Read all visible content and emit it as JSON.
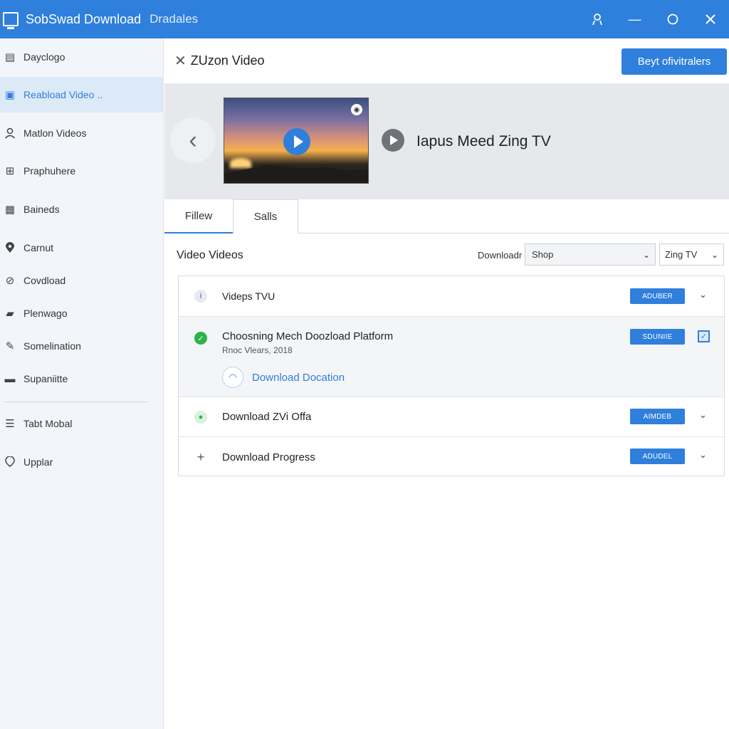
{
  "titlebar": {
    "title": "SobSwad Download",
    "subtitle": "Dradales"
  },
  "sidebar": {
    "items": [
      {
        "label": "Dayclogo",
        "icon": "page-icon"
      },
      {
        "label": "Reabload Video ..",
        "icon": "folder-icon",
        "active": true
      },
      {
        "label": "Matlon Videos",
        "icon": "user-icon"
      },
      {
        "label": "Praphuhere",
        "icon": "grid-icon"
      },
      {
        "label": "Baineds",
        "icon": "board-icon"
      },
      {
        "label": "Carnut",
        "icon": "location-pin-icon"
      },
      {
        "label": "Covdload",
        "icon": "refresh-icon"
      },
      {
        "label": "Plenwago",
        "icon": "image-icon"
      },
      {
        "label": "Somelination",
        "icon": "pen-icon"
      },
      {
        "label": "Supaniitte",
        "icon": "case-icon"
      },
      {
        "label": "Tabt Mobal",
        "icon": "menu-icon"
      },
      {
        "label": "Upplar",
        "icon": "balloon-icon"
      }
    ]
  },
  "header": {
    "title": "ZUzon Video",
    "primary_button": "Beyt ofivitralers"
  },
  "preview": {
    "video_name": "Iapus Meed Zing TV"
  },
  "tabs": [
    {
      "label": "Fillew",
      "active": true
    },
    {
      "label": "Salls"
    }
  ],
  "section": {
    "title": "Video Videos",
    "filter_label": "Downloadr",
    "select1": "Shop",
    "select2": "Zing TV"
  },
  "list": {
    "rows": [
      {
        "title": "Videps TVU",
        "button": "ADUBER",
        "icon": "info-icon"
      },
      {
        "title": "Choosning Mech Doozload Platform",
        "subtitle": "Rnoc Vlears, 2018",
        "button": "SDUNIIE",
        "icon": "check-circle-icon",
        "link": "Download Docation"
      },
      {
        "title": "Download ZVi Offa",
        "button": "AIMDEB",
        "icon": "dot-icon"
      },
      {
        "title": "Download Progress",
        "button": "ADUDEL",
        "icon": "plus-icon"
      }
    ]
  },
  "colors": {
    "accent": "#2f7fdc",
    "success": "#2db24a",
    "sidebar_bg": "#f2f6fa",
    "active_bg": "#dce9f7"
  }
}
